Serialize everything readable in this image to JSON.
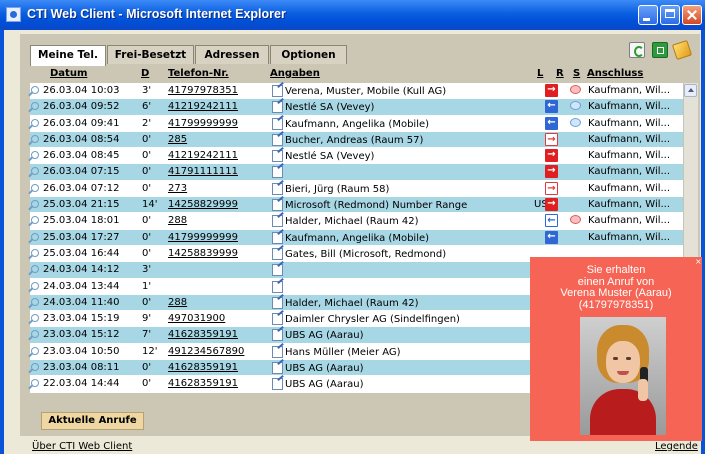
{
  "window": {
    "title": "CTI Web Client - Microsoft Internet Explorer"
  },
  "tabs": [
    "Meine Tel.",
    "Frei-Besetzt",
    "Adressen",
    "Optionen"
  ],
  "toolbar_icons": [
    "refresh-icon",
    "green-box-icon",
    "tag-icon"
  ],
  "columns": {
    "datum": "Datum",
    "d": "D",
    "telefon": "Telefon-Nr.",
    "angaben": "Angaben",
    "l": "L",
    "r": "R",
    "s": "S",
    "anschluss": "Anschluss"
  },
  "rows": [
    {
      "datum": "26.03.04 10:03",
      "d": "3'",
      "telefon": "41797978351",
      "angaben": "Verena, Muster, Mobile (Kull AG)",
      "l": "",
      "r": "red",
      "s": "pink",
      "anschluss": "Kaufmann, Wil..."
    },
    {
      "datum": "26.03.04 09:52",
      "d": "6'",
      "telefon": "41219242111",
      "angaben": "Nestlé SA (Vevey)",
      "l": "",
      "r": "blue",
      "s": "lb",
      "anschluss": "Kaufmann, Wil..."
    },
    {
      "datum": "26.03.04 09:41",
      "d": "2'",
      "telefon": "41799999999",
      "angaben": "Kaufmann, Angelika (Mobile)",
      "l": "",
      "r": "blue",
      "s": "lb",
      "anschluss": "Kaufmann, Wil..."
    },
    {
      "datum": "26.03.04 08:54",
      "d": "0'",
      "telefon": "285",
      "angaben": "Bucher, Andreas (Raum 57)",
      "l": "",
      "r": "ored",
      "s": "",
      "anschluss": "Kaufmann, Wil..."
    },
    {
      "datum": "26.03.04 08:45",
      "d": "0'",
      "telefon": "41219242111",
      "angaben": "Nestlé SA (Vevey)",
      "l": "",
      "r": "red",
      "s": "",
      "anschluss": "Kaufmann, Wil..."
    },
    {
      "datum": "26.03.04 07:15",
      "d": "0'",
      "telefon": "41791111111",
      "angaben": "",
      "l": "",
      "r": "red",
      "s": "",
      "anschluss": "Kaufmann, Wil..."
    },
    {
      "datum": "26.03.04 07:12",
      "d": "0'",
      "telefon": "273",
      "angaben": "Bieri, Jürg (Raum 58)",
      "l": "",
      "r": "ored",
      "s": "",
      "anschluss": "Kaufmann, Wil..."
    },
    {
      "datum": "25.03.04 21:15",
      "d": "14'",
      "telefon": "14258829999",
      "angaben": "Microsoft (Redmond) Number Range",
      "l": "US",
      "r": "red",
      "s": "",
      "anschluss": "Kaufmann, Wil..."
    },
    {
      "datum": "25.03.04 18:01",
      "d": "0'",
      "telefon": "288",
      "angaben": "Halder, Michael (Raum 42)",
      "l": "",
      "r": "oblue",
      "s": "pink",
      "anschluss": "Kaufmann, Wil..."
    },
    {
      "datum": "25.03.04 17:27",
      "d": "0'",
      "telefon": "41799999999",
      "angaben": "Kaufmann, Angelika (Mobile)",
      "l": "",
      "r": "blue",
      "s": "",
      "anschluss": "Kaufmann, Wil..."
    },
    {
      "datum": "25.03.04 16:44",
      "d": "0'",
      "telefon": "14258839999",
      "angaben": "Gates, Bill (Microsoft, Redmond)",
      "l": "",
      "r": "",
      "s": "",
      "anschluss": ""
    },
    {
      "datum": "24.03.04 14:12",
      "d": "3'",
      "telefon": "",
      "angaben": "",
      "l": "",
      "r": "",
      "s": "",
      "anschluss": ""
    },
    {
      "datum": "24.03.04 13:44",
      "d": "1'",
      "telefon": "",
      "angaben": "",
      "l": "",
      "r": "",
      "s": "",
      "anschluss": ""
    },
    {
      "datum": "24.03.04 11:40",
      "d": "0'",
      "telefon": "288",
      "angaben": "Halder, Michael (Raum 42)",
      "l": "",
      "r": "",
      "s": "",
      "anschluss": ""
    },
    {
      "datum": "23.03.04 15:19",
      "d": "9'",
      "telefon": "497031900",
      "angaben": "Daimler Chrysler AG (Sindelfingen)",
      "l": "",
      "r": "",
      "s": "",
      "anschluss": ""
    },
    {
      "datum": "23.03.04 15:12",
      "d": "7'",
      "telefon": "41628359191",
      "angaben": "UBS AG (Aarau)",
      "l": "",
      "r": "",
      "s": "",
      "anschluss": ""
    },
    {
      "datum": "23.03.04 10:50",
      "d": "12'",
      "telefon": "491234567890",
      "angaben": "Hans Müller (Meier AG)",
      "l": "",
      "r": "",
      "s": "",
      "anschluss": ""
    },
    {
      "datum": "23.03.04 08:11",
      "d": "0'",
      "telefon": "41628359191",
      "angaben": "UBS AG (Aarau)",
      "l": "",
      "r": "",
      "s": "",
      "anschluss": ""
    },
    {
      "datum": "22.03.04 14:44",
      "d": "0'",
      "telefon": "41628359191",
      "angaben": "UBS AG (Aarau)",
      "l": "",
      "r": "",
      "s": "",
      "anschluss": ""
    }
  ],
  "aktuelle_anrufe": "Aktuelle Anrufe",
  "footer": {
    "about": "Über CTI Web Client",
    "legend": "Legende"
  },
  "popup": {
    "line1": "Sie erhalten",
    "line2": "einen Anruf von",
    "line3": "Verena Muster (Aarau)",
    "line4": "(41797978351)"
  }
}
